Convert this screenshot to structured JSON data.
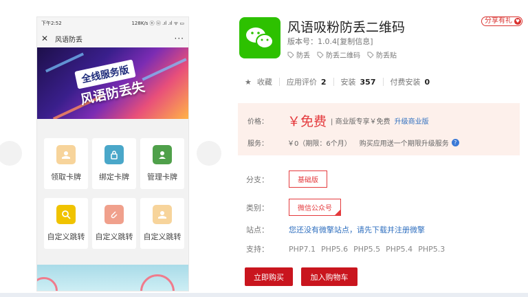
{
  "preview": {
    "status_time": "下午2:52",
    "status_right": "128K/s ⓝ ⓤ .ıl .ıl ᯤ ▭",
    "nav_title": "风语防丢",
    "nav_more": "···",
    "banner_tag": "全线服务版",
    "banner_headline": "风语防丢失",
    "tiles": [
      {
        "label": "领取卡牌",
        "icon": "hand-card-icon",
        "color": "#f7d49b"
      },
      {
        "label": "绑定卡牌",
        "icon": "lock-icon",
        "color": "#4aa7c9"
      },
      {
        "label": "管理卡牌",
        "icon": "person-card-icon",
        "color": "#4fa04a"
      },
      {
        "label": "自定义跳转",
        "icon": "search-icon",
        "color": "#f0c300"
      },
      {
        "label": "自定义跳转",
        "icon": "paperclip-icon",
        "color": "#f0a08c"
      },
      {
        "label": "自定义跳转",
        "icon": "hand-card-icon",
        "color": "#f7d49b"
      }
    ]
  },
  "app": {
    "title": "风语吸粉防丢二维码",
    "version": "版本号：1.0.4[复制信息]",
    "share_badge": "分享有礼",
    "tags": [
      "防丢",
      "防丢二维码",
      "防丢贴"
    ],
    "icon": "wechat-icon",
    "brand_color": "#2dc100"
  },
  "stats": {
    "favorite_label": "收藏",
    "rating_label": "应用评价",
    "rating_value": "2",
    "install_label": "安装",
    "install_value": "357",
    "paid_label": "付费安装",
    "paid_value": "0"
  },
  "pricing": {
    "price_label": "价格：",
    "price_value": "￥免费",
    "price_note": "| 商业版专享￥免费",
    "upgrade_link": "升级商业版",
    "service_label": "服务：",
    "service_value": "￥0（期限：6个月）",
    "service_note": "购买应用送一个期限升级服务"
  },
  "specs": {
    "branch_label": "分支：",
    "branch_value": "基础版",
    "category_label": "类别：",
    "category_value": "微信公众号",
    "site_label": "站点：",
    "site_value": "您还没有微擎站点，请先下载并注册微擎",
    "support_label": "支持：",
    "support_values": [
      "PHP7.1",
      "PHP5.6",
      "PHP5.5",
      "PHP5.4",
      "PHP5.3"
    ]
  },
  "actions": {
    "buy_label": "立即购买",
    "cart_label": "加入购物车",
    "accent": "#c9151e"
  }
}
